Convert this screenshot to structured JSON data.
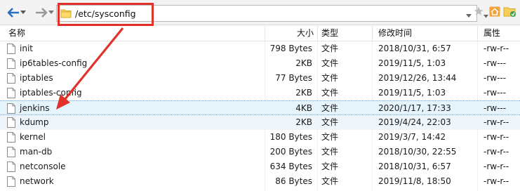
{
  "address": {
    "path": "/etc/sysconfig"
  },
  "columns": {
    "name": "名称",
    "size": "大小",
    "type": "类型",
    "modified": "修改时间",
    "attributes": "属性"
  },
  "files": [
    {
      "name": "init",
      "size": "798 Bytes",
      "type": "文件",
      "modified": "2018/10/31, 6:57",
      "perm": "-rw-r--"
    },
    {
      "name": "ip6tables-config",
      "size": "2KB",
      "type": "文件",
      "modified": "2019/11/5, 1:03",
      "perm": "-rw---"
    },
    {
      "name": "iptables",
      "size": "77 Bytes",
      "type": "文件",
      "modified": "2019/12/26, 13:44",
      "perm": "-rw---"
    },
    {
      "name": "iptables-config",
      "size": "2KB",
      "type": "文件",
      "modified": "2019/11/5, 1:03",
      "perm": "-rw---"
    },
    {
      "name": "jenkins",
      "size": "4KB",
      "type": "文件",
      "modified": "2020/1/17, 17:33",
      "perm": "-rw---"
    },
    {
      "name": "kdump",
      "size": "2KB",
      "type": "文件",
      "modified": "2019/4/24, 22:03",
      "perm": "-rw-r--"
    },
    {
      "name": "kernel",
      "size": "180 Bytes",
      "type": "文件",
      "modified": "2019/3/7, 14:42",
      "perm": "-rw-r--"
    },
    {
      "name": "man-db",
      "size": "200 Bytes",
      "type": "文件",
      "modified": "2018/10/30, 22:55",
      "perm": "-rw-r--"
    },
    {
      "name": "netconsole",
      "size": "634 Bytes",
      "type": "文件",
      "modified": "2018/10/31, 6:57",
      "perm": "-rw-r--"
    },
    {
      "name": "network",
      "size": "86 Bytes",
      "type": "文件",
      "modified": "2019/11/8, 18:50",
      "perm": "-rw-r--"
    }
  ],
  "colors": {
    "highlight_box": "#e0322a",
    "arrow": "#e0322a",
    "selected_row": "#e5f3fb"
  },
  "icons": [
    "back-arrow-icon",
    "forward-arrow-icon",
    "folder-icon",
    "star-icon",
    "home-icon",
    "file-icon"
  ]
}
